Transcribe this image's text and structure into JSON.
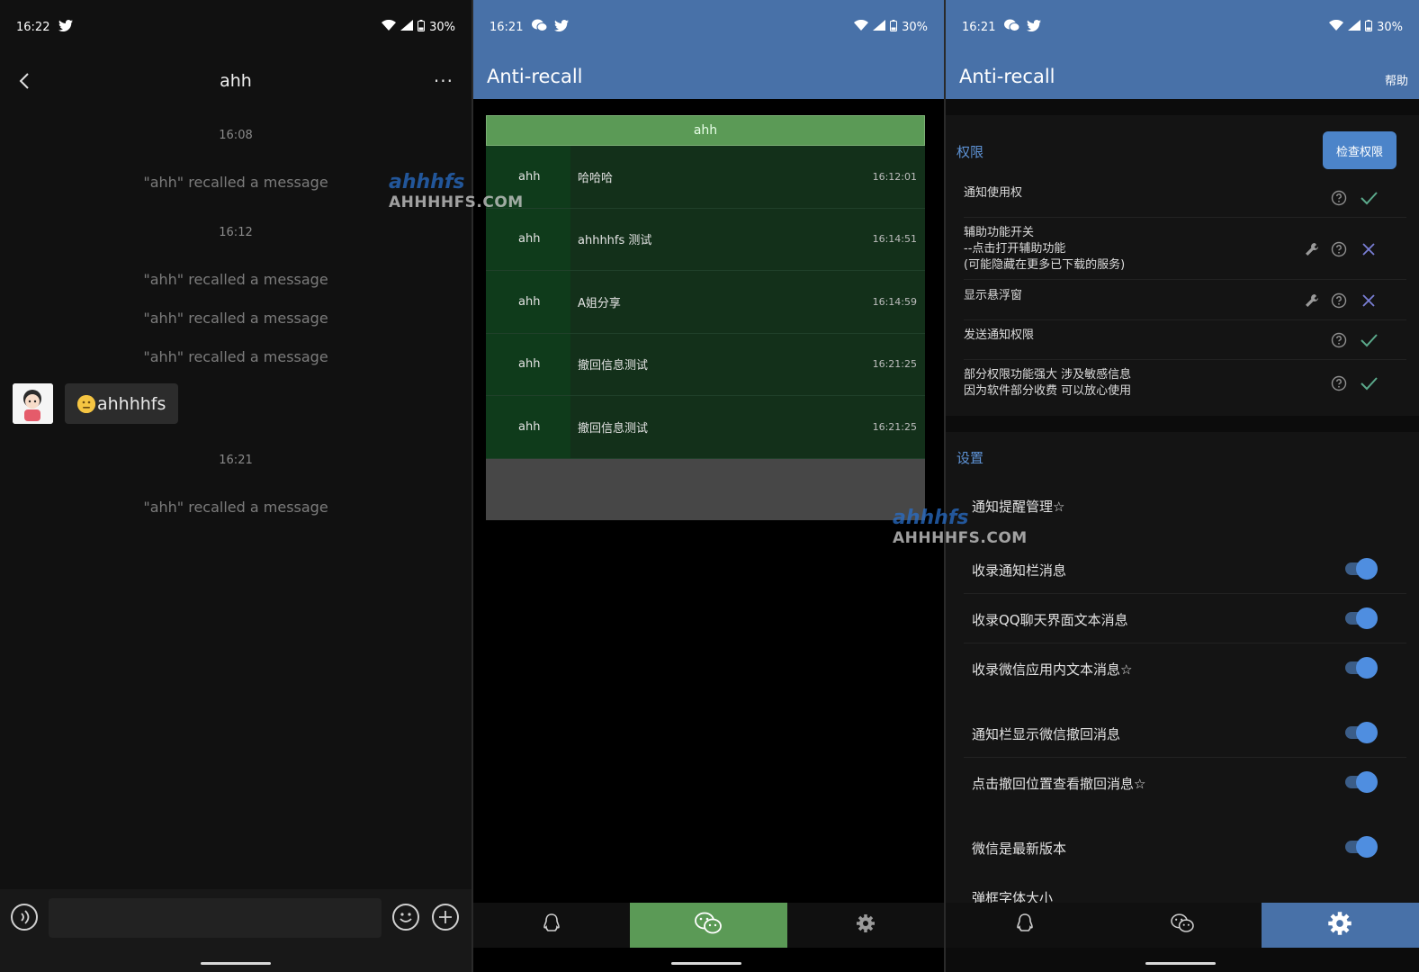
{
  "panel1": {
    "status": {
      "time": "16:22",
      "battery": "30%"
    },
    "title": "ahh",
    "more": "···",
    "messages": [
      {
        "kind": "time",
        "text": "16:08"
      },
      {
        "kind": "system",
        "text": "\"ahh\" recalled a message"
      },
      {
        "kind": "time",
        "text": "16:12"
      },
      {
        "kind": "system",
        "text": "\"ahh\" recalled a message"
      },
      {
        "kind": "system",
        "text": "\"ahh\" recalled a message"
      },
      {
        "kind": "system",
        "text": "\"ahh\" recalled a message"
      },
      {
        "kind": "bubble",
        "text": "ahhhhfs"
      },
      {
        "kind": "time",
        "text": "16:21"
      },
      {
        "kind": "system",
        "text": "\"ahh\" recalled a message"
      }
    ]
  },
  "panel2": {
    "status": {
      "time": "16:21",
      "battery": "30%"
    },
    "app_title": "Anti-recall",
    "group_header": "ahh",
    "records": [
      {
        "name": "ahh",
        "msg": "哈哈哈",
        "time": "16:12:01"
      },
      {
        "name": "ahh",
        "msg": "ahhhhfs 测试",
        "time": "16:14:51"
      },
      {
        "name": "ahh",
        "msg": "A姐分享",
        "time": "16:14:59"
      },
      {
        "name": "ahh",
        "msg": "撤回信息测试",
        "time": "16:21:25"
      },
      {
        "name": "ahh",
        "msg": "撤回信息测试",
        "time": "16:21:25"
      }
    ]
  },
  "panel3": {
    "status": {
      "time": "16:21",
      "battery": "30%"
    },
    "app_title": "Anti-recall",
    "help": "帮助",
    "permissions_title": "权限",
    "check_button": "检查权限",
    "permissions": [
      {
        "lines": [
          "通知使用权"
        ],
        "status": "ok"
      },
      {
        "lines": [
          "辅助功能开关",
          "--点击打开辅助功能",
          "(可能隐藏在更多已下载的服务)"
        ],
        "status": "missing"
      },
      {
        "lines": [
          "显示悬浮窗"
        ],
        "status": "missing"
      },
      {
        "lines": [
          "发送通知权限"
        ],
        "status": "ok"
      },
      {
        "lines": [
          "部分权限功能强大 涉及敏感信息",
          "因为软件部分收费 可以放心使用"
        ],
        "status": "ok"
      }
    ],
    "settings_title": "设置",
    "settings": [
      {
        "label": "通知提醒管理☆",
        "toggle": null
      },
      {
        "label": "收录通知栏消息",
        "toggle": true
      },
      {
        "label": "收录QQ聊天界面文本消息",
        "toggle": true
      },
      {
        "label": "收录微信应用内文本消息☆",
        "toggle": true
      },
      {
        "label": "通知栏显示微信撤回消息",
        "toggle": true
      },
      {
        "label": "点击撤回位置查看撤回消息☆",
        "toggle": true
      },
      {
        "label": "微信是最新版本",
        "toggle": true
      },
      {
        "label": "弹框字体大小",
        "toggle": null
      }
    ]
  },
  "watermark": {
    "top": "ahhhfs",
    "bottom": "AHHHHFS.COM"
  },
  "colors": {
    "appbar": "#4871a8",
    "green": "#5b9a56",
    "accent": "#4f8ee0",
    "ok": "#5ba98b",
    "missing": "#7a7fd6"
  }
}
